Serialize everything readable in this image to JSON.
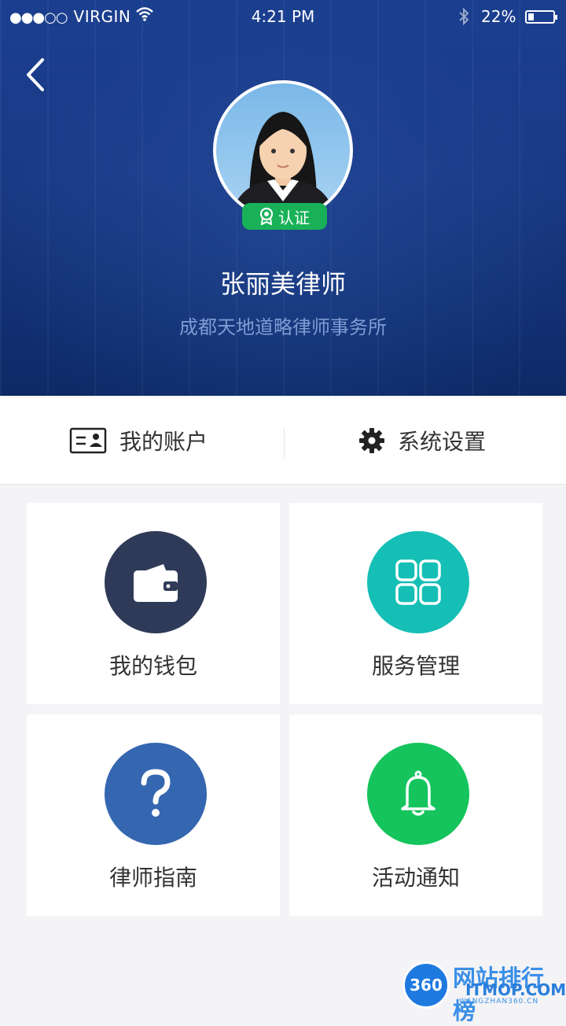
{
  "status_bar": {
    "signal_dots": "●●●○○",
    "carrier": "VIRGIN",
    "time": "4:21 PM",
    "battery_percent": "22%"
  },
  "profile": {
    "name": "张丽美律师",
    "firm": "成都天地道略律师事务所",
    "badge": "认证"
  },
  "nav": {
    "account": "我的账户",
    "settings": "系统设置"
  },
  "tiles": [
    {
      "label": "我的钱包",
      "color": "#2e3a57",
      "icon": "wallet-icon"
    },
    {
      "label": "服务管理",
      "color": "#15bfb5",
      "icon": "grid-icon"
    },
    {
      "label": "律师指南",
      "color": "#3566b0",
      "icon": "question-icon"
    },
    {
      "label": "活动通知",
      "color": "#15c45c",
      "icon": "bell-icon"
    }
  ],
  "watermark": {
    "text": "网站排行榜",
    "sub": "ITMOP.COM",
    "domain": "WANGZHAN360.CN",
    "logo_text": "360"
  }
}
